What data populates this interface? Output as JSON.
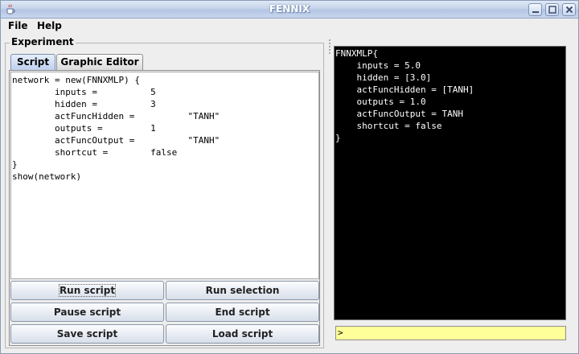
{
  "window": {
    "title": "FENNIX"
  },
  "menu": {
    "file": "File",
    "help": "Help"
  },
  "experiment": {
    "label": "Experiment"
  },
  "tabs": {
    "script": "Script",
    "graphic_editor": "Graphic Editor"
  },
  "editor": {
    "script": "network = new(FNNXMLP) {\n        inputs =          5\n        hidden =          3\n        actFuncHidden =          \"TANH\"\n        outputs =         1\n        actFuncOutput =          \"TANH\"\n        shortcut =        false\n}\nshow(network)"
  },
  "buttons": {
    "run_script": "Run script",
    "run_selection": "Run selection",
    "pause_script": "Pause script",
    "end_script": "End script",
    "save_script": "Save script",
    "load_script": "Load script"
  },
  "output": {
    "text": "FNNXMLP{\n    inputs = 5.0\n    hidden = [3.0]\n    actFuncHidden = [TANH]\n    outputs = 1.0\n    actFuncOutput = TANH\n    shortcut = false\n}"
  },
  "command": {
    "prompt": ">"
  },
  "icons": {
    "app": "java-coffee-cup-icon",
    "minimize": "minimize-icon",
    "maximize": "maximize-icon",
    "close": "close-icon"
  },
  "colors": {
    "output_bg": "#000000",
    "output_fg": "#ffffff",
    "command_bg": "#ffff99"
  }
}
